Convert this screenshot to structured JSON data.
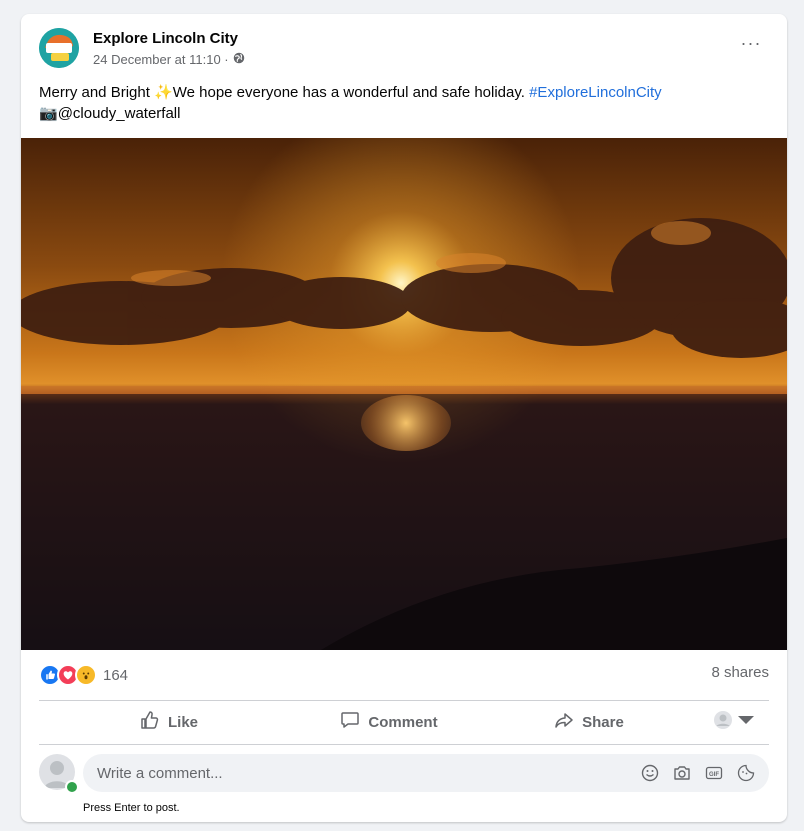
{
  "post": {
    "page_name": "Explore Lincoln City",
    "timestamp": "24 December at 11:10 ·",
    "audience_icon": "globe-icon",
    "more_label": "···",
    "text_part1": "Merry and Bright",
    "sparkle_emoji": "✨",
    "text_part2": "We hope everyone has a wonderful and safe holiday.",
    "hashtag": "#ExploreLincolnCity",
    "camera_emoji": "📷",
    "credit": "@cloudy_waterfall",
    "photo_description_icon": "sunset-photo"
  },
  "stats": {
    "reaction_icons": [
      "like-icon",
      "love-icon",
      "wow-icon"
    ],
    "reaction_count": "164",
    "shares": "8 shares"
  },
  "actions": {
    "like": "Like",
    "comment": "Comment",
    "share": "Share"
  },
  "comment": {
    "placeholder": "Write a comment...",
    "hint": "Press Enter to post."
  },
  "colors": {
    "hashtag": "#216fdb",
    "like": "#1877f2",
    "love": "#f33e58",
    "wow": "#f7b928"
  }
}
